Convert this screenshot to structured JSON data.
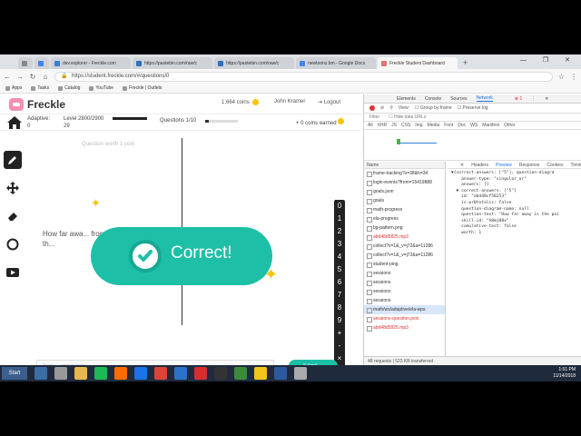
{
  "browser": {
    "tabs": [
      {
        "label": "",
        "color": "#888"
      },
      {
        "label": "",
        "color": "#4285f4"
      },
      {
        "label": "dev.explorer - Freckle.com",
        "color": "#3b7dd8"
      },
      {
        "label": "https://pastebin.com/raw/c",
        "color": "#2e6fbf"
      },
      {
        "label": "https://pastebin.com/raw/c",
        "color": "#2e6fbf"
      },
      {
        "label": "newtoonz.bm - Google Docs",
        "color": "#4285f4"
      },
      {
        "label": "Freckle Student Dashboard",
        "color": "#e57373"
      }
    ],
    "url": "https://student.freckle.com/#/questions/0",
    "bookmarks": [
      "Apps",
      "Tasks",
      "Catalog",
      "YouTube",
      "Freckle | Outlets"
    ]
  },
  "freckle": {
    "app_name": "Freckle",
    "coins": "1,664 coins",
    "username": "John Kramer",
    "logout": "Logout",
    "adaptive_label": "Adaptive:",
    "adaptive_value": "0",
    "level_label": "Level",
    "level_progress": "2800/2900",
    "level_value": "29",
    "questions_label": "Questions",
    "questions_progress": "1/10",
    "coins_earned": "+ 0 coins earned",
    "question_hint": "Question worth 1 coin",
    "question_text": "How far awa... from th...",
    "correct_text": "Correct!",
    "keypad": [
      "0",
      "1",
      "2",
      "3",
      "4",
      "5",
      "6",
      "7",
      "8",
      "9",
      "+",
      "-",
      "×",
      "÷"
    ],
    "answer_placeholder": "Type y... answer here",
    "submit_label": "Submit →"
  },
  "devtools": {
    "tabs": [
      "Elements",
      "Console",
      "Sources",
      "Network"
    ],
    "errors": "1",
    "toolbar": [
      "View:",
      "Group by frame",
      "Preserve log"
    ],
    "filter": [
      "Filter",
      "Hide data URLs"
    ],
    "types": [
      "All",
      "XHR",
      "JS",
      "CSS",
      "Img",
      "Media",
      "Font",
      "Doc",
      "WS",
      "Manifest",
      "Other"
    ],
    "list_header": "Name",
    "requests": [
      {
        "name": "frame-tracking?v=38&h=34",
        "err": false,
        "sel": false
      },
      {
        "name": "login-events?from=15419888",
        "err": false,
        "sel": false
      },
      {
        "name": "goals.json",
        "err": false,
        "sel": false
      },
      {
        "name": "goals",
        "err": false,
        "sel": false
      },
      {
        "name": "math-progress",
        "err": false,
        "sel": false
      },
      {
        "name": "ela-progress",
        "err": false,
        "sel": false
      },
      {
        "name": "bg-pattern.png",
        "err": false,
        "sel": false
      },
      {
        "name": "abd48d5825.mp3",
        "err": true,
        "sel": false
      },
      {
        "name": "collect?v=1&_v=j72&a=11286",
        "err": false,
        "sel": false
      },
      {
        "name": "collect?v=1&_v=j72&a=11286",
        "err": false,
        "sel": false
      },
      {
        "name": "student-ping",
        "err": false,
        "sel": false
      },
      {
        "name": "sessions",
        "err": false,
        "sel": false
      },
      {
        "name": "sessions",
        "err": false,
        "sel": false
      },
      {
        "name": "sessions",
        "err": false,
        "sel": false
      },
      {
        "name": "sessions",
        "err": false,
        "sel": false
      },
      {
        "name": "math/ws/adaptive/ela-wps",
        "err": false,
        "sel": true
      },
      {
        "name": "sessions-question.json",
        "err": true,
        "sel": false
      },
      {
        "name": "abd48d5825.mp3",
        "err": true,
        "sel": false
      }
    ],
    "preview_tabs": [
      "Headers",
      "Preview",
      "Response",
      "Cookies",
      "Timing"
    ],
    "json_lines": [
      "▼{correct-answers: [\"5\"], question-diagra",
      "    answer-type: \"singular_or\"",
      "    answers: []",
      "  ▼ correct-answers: [\"5\"]",
      "    id: \"abd48cf58253\"",
      "    is-pr0totalis: false",
      "    question-diagram-name: null",
      "    question-text: \"How far away is the poi",
      "    skill-id: \"h8mj08x\"",
      "    cumulative-test: false",
      "    worth: 1"
    ],
    "footer": "48 requests | 523 KB transferred"
  },
  "taskbar": {
    "start": "Start",
    "icons": [
      "#3a6ea5",
      "#999",
      "#e8b84a",
      "#1db954",
      "#ff6d00",
      "#1a73e8",
      "#db4437",
      "#2b73c9",
      "#d32f2f",
      "#333",
      "#3a8a3a",
      "#f0c419",
      "#2c5aa0",
      "#aaa"
    ],
    "time": "1:51 PM",
    "date": "11/14/2018"
  }
}
